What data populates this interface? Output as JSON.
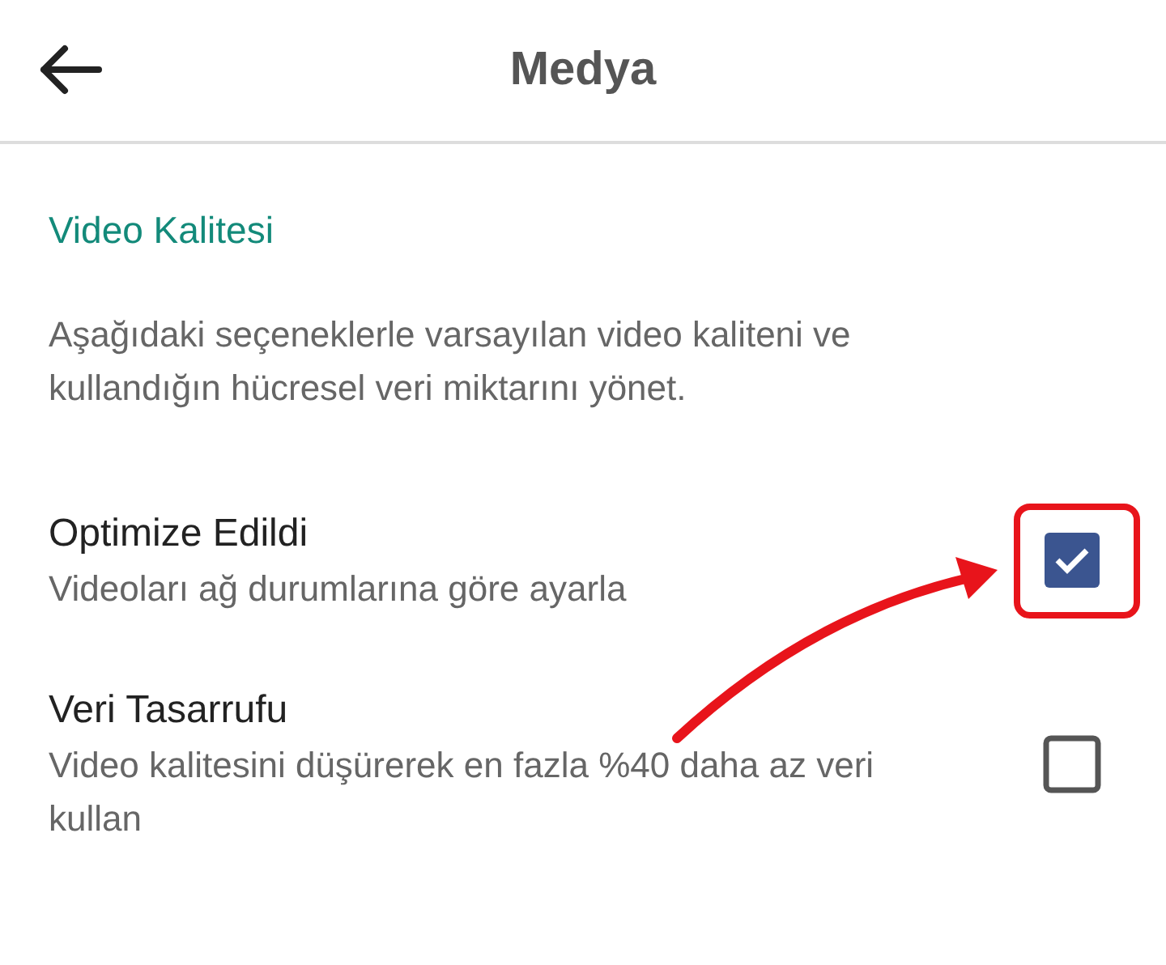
{
  "header": {
    "title": "Medya"
  },
  "section": {
    "title": "Video Kalitesi",
    "description": "Aşağıdaki seçeneklerle varsayılan video kaliteni ve kullandığın hücresel veri miktarını yönet."
  },
  "options": [
    {
      "title": "Optimize Edildi",
      "subtitle": "Videoları ağ durumlarına göre ayarla",
      "checked": true,
      "highlighted": true
    },
    {
      "title": "Veri Tasarrufu",
      "subtitle": "Video kalitesini düşürerek en fazla %40 daha az veri kullan",
      "checked": false,
      "highlighted": false
    }
  ]
}
